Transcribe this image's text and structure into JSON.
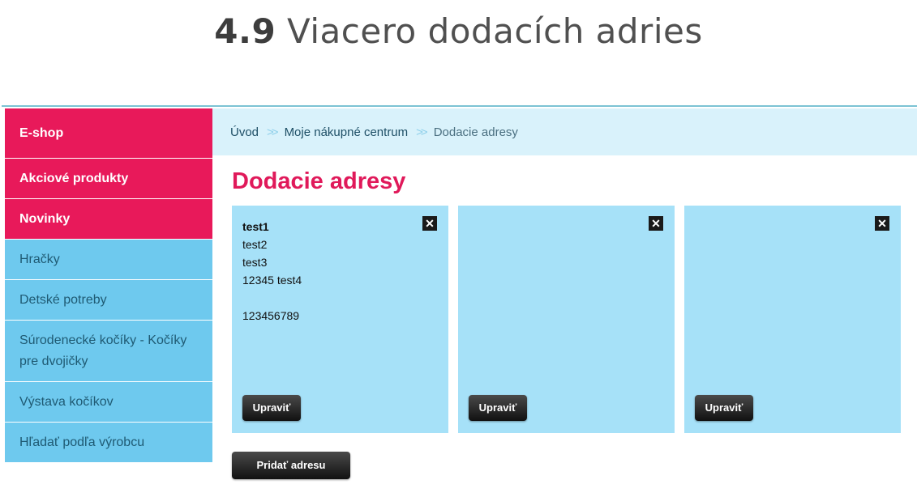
{
  "doc_heading": {
    "number": "4.9",
    "text": "Viacero dodacích adries"
  },
  "sidebar": {
    "items": [
      {
        "label": "E-shop",
        "style": "pink"
      },
      {
        "label": "Akciové produkty",
        "style": "pink"
      },
      {
        "label": "Novinky",
        "style": "pink"
      },
      {
        "label": "Hračky",
        "style": "blue"
      },
      {
        "label": "Detské potreby",
        "style": "blue"
      },
      {
        "label": "Súrodenecké kočíky - Kočíky pre dvojičky",
        "style": "blue"
      },
      {
        "label": "Výstava kočíkov",
        "style": "blue"
      },
      {
        "label": "Hľadať podľa výrobcu",
        "style": "blue"
      }
    ]
  },
  "breadcrumb": {
    "items": [
      "Úvod",
      "Moje nákupné centrum",
      "Dodacie adresy"
    ],
    "separator": "»"
  },
  "page_title": "Dodacie adresy",
  "addresses": [
    {
      "name": "test1",
      "line2": "test2",
      "line3": "test3",
      "line4": "12345 test4",
      "phone": "123456789",
      "close": "✕",
      "edit_label": "Upraviť"
    },
    {
      "close": "✕",
      "edit_label": "Upraviť"
    },
    {
      "close": "✕",
      "edit_label": "Upraviť"
    }
  ],
  "add_button_label": "Pridať adresu",
  "colors": {
    "pink": "#e8195a",
    "blue": "#6ec9ee",
    "card": "#a6e1f8",
    "breadcrumb_bg": "#d9f2fb"
  }
}
